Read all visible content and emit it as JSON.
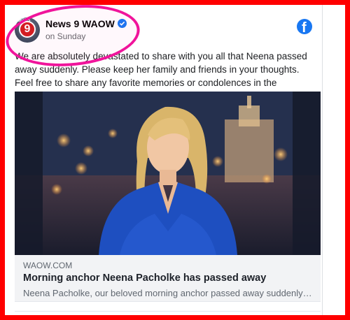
{
  "post": {
    "page_name": "News 9 WAOW",
    "time": "on Sunday",
    "text": "We are absolutely devastated to share with you all that Neena passed away suddenly. Please keep her family and friends in your thoughts. Feel free to share any favorite memories or condolences in the comments below.",
    "avatar_badge": "9",
    "avatar_text": "NEWS"
  },
  "link_preview": {
    "domain": "WAOW.COM",
    "title": "Morning anchor Neena Pacholke has passed away",
    "description": "Neena Pacholke, our beloved morning anchor passed away suddenly S..."
  },
  "icons": {
    "platform": "facebook-icon",
    "verified": "verified-badge-icon"
  },
  "colors": {
    "frame": "#ff0000",
    "annotation_circle": "#f0149b",
    "facebook_blue": "#1877f2"
  }
}
